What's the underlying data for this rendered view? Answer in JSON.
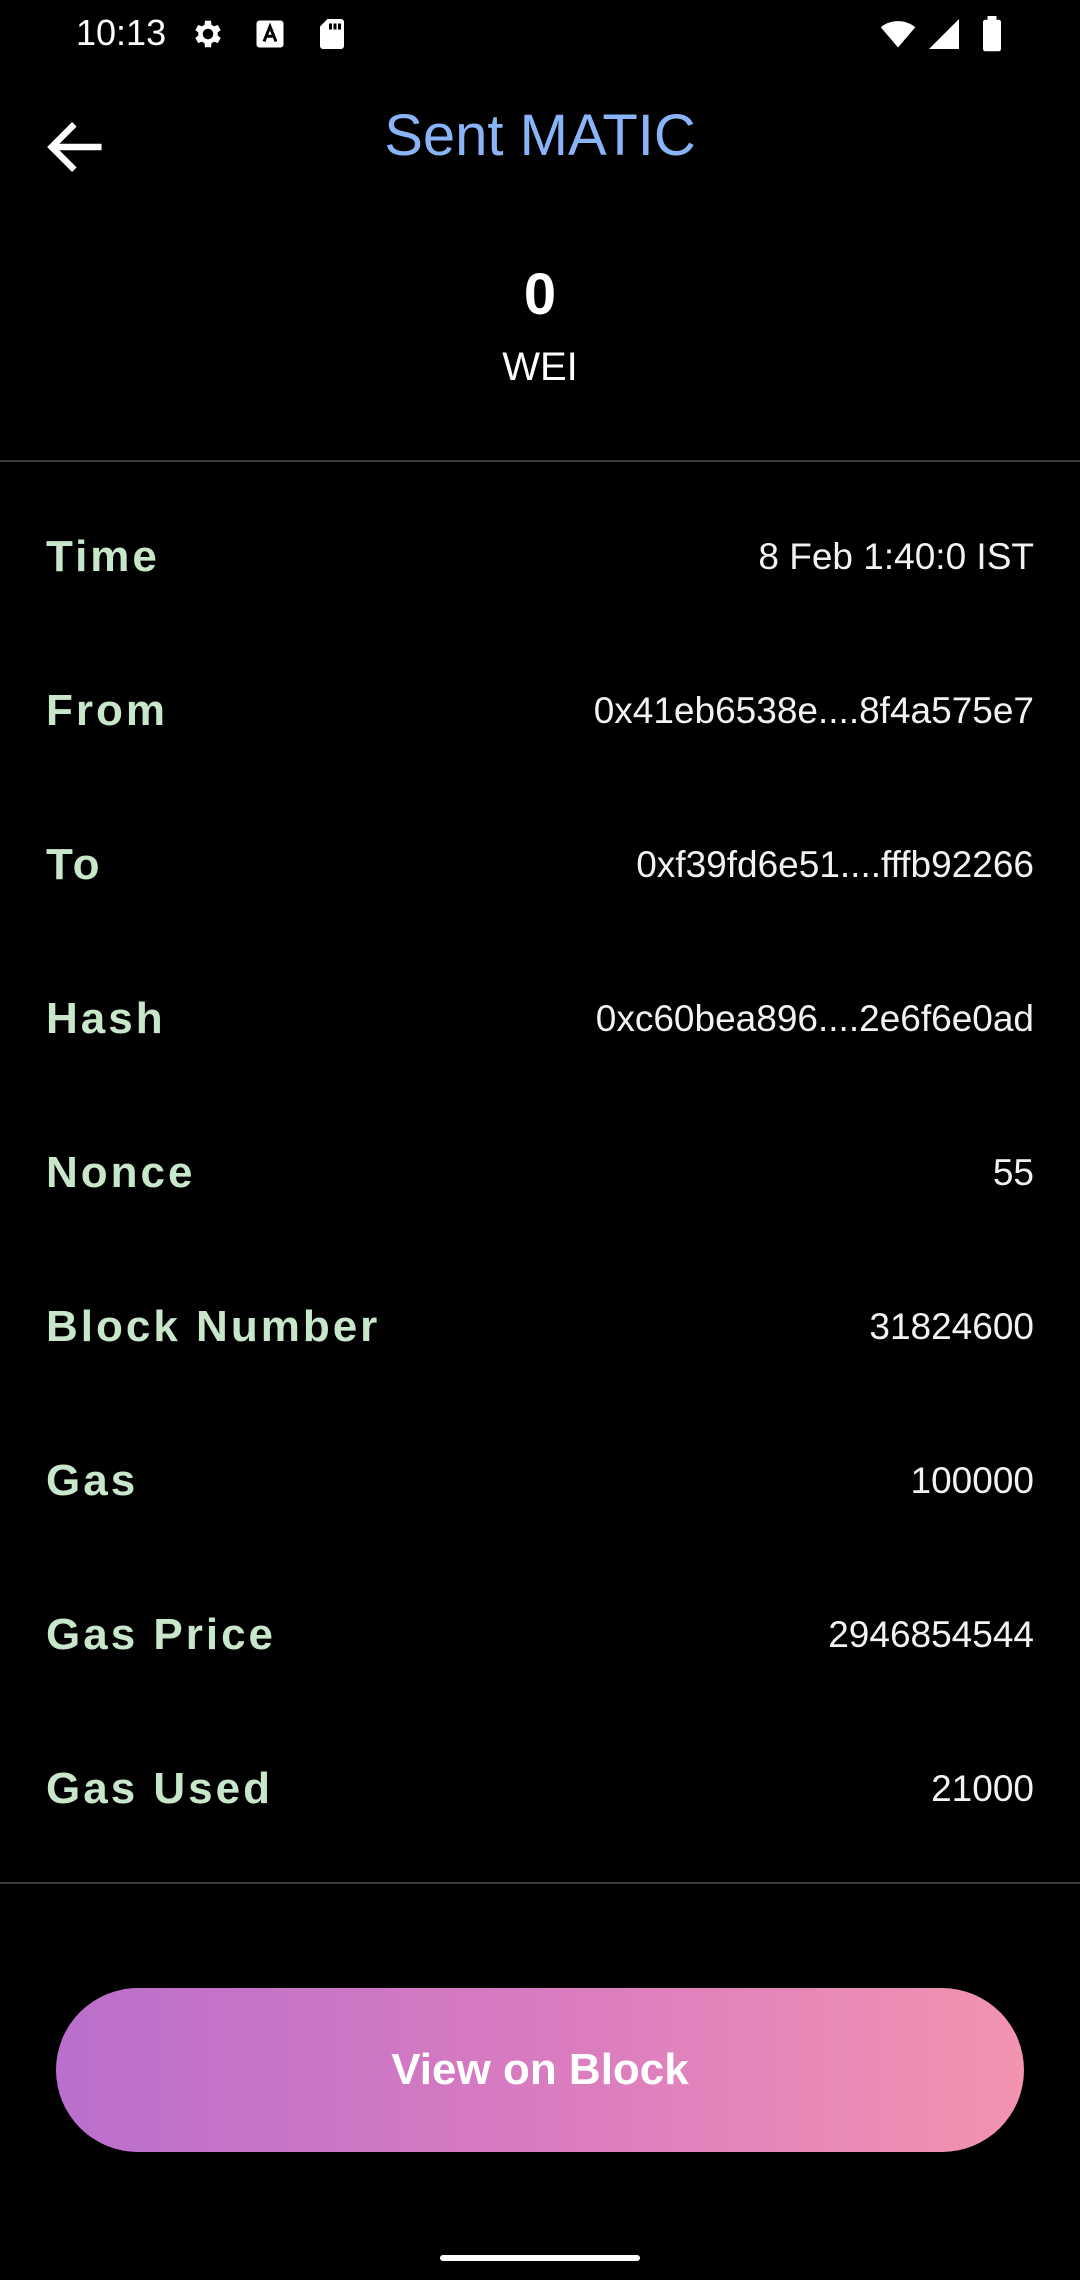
{
  "status_bar": {
    "time": "10:13",
    "icons": [
      "settings-icon",
      "font-icon",
      "sd-card-icon",
      "wifi-icon",
      "signal-icon",
      "battery-icon"
    ]
  },
  "header": {
    "title": "Sent MATIC",
    "back_icon": "arrow-left-icon"
  },
  "amount": {
    "value": "0",
    "unit": "WEI"
  },
  "details": [
    {
      "label": "Time",
      "value": "8 Feb 1:40:0 IST"
    },
    {
      "label": "From",
      "value": "0x41eb6538e....8f4a575e7"
    },
    {
      "label": "To",
      "value": "0xf39fd6e51....fffb92266"
    },
    {
      "label": "Hash",
      "value": "0xc60bea896....2e6f6e0ad"
    },
    {
      "label": "Nonce",
      "value": "55"
    },
    {
      "label": "Block Number",
      "value": "31824600"
    },
    {
      "label": "Gas",
      "value": "100000"
    },
    {
      "label": "Gas Price",
      "value": "2946854544"
    },
    {
      "label": "Gas Used",
      "value": "21000"
    }
  ],
  "action": {
    "label": "View on Block"
  },
  "colors": {
    "background": "#000000",
    "title": "#8ab4f8",
    "label": "#c8e6c9",
    "button_gradient_start": "#b96fcc",
    "button_gradient_end": "#f293b0"
  }
}
